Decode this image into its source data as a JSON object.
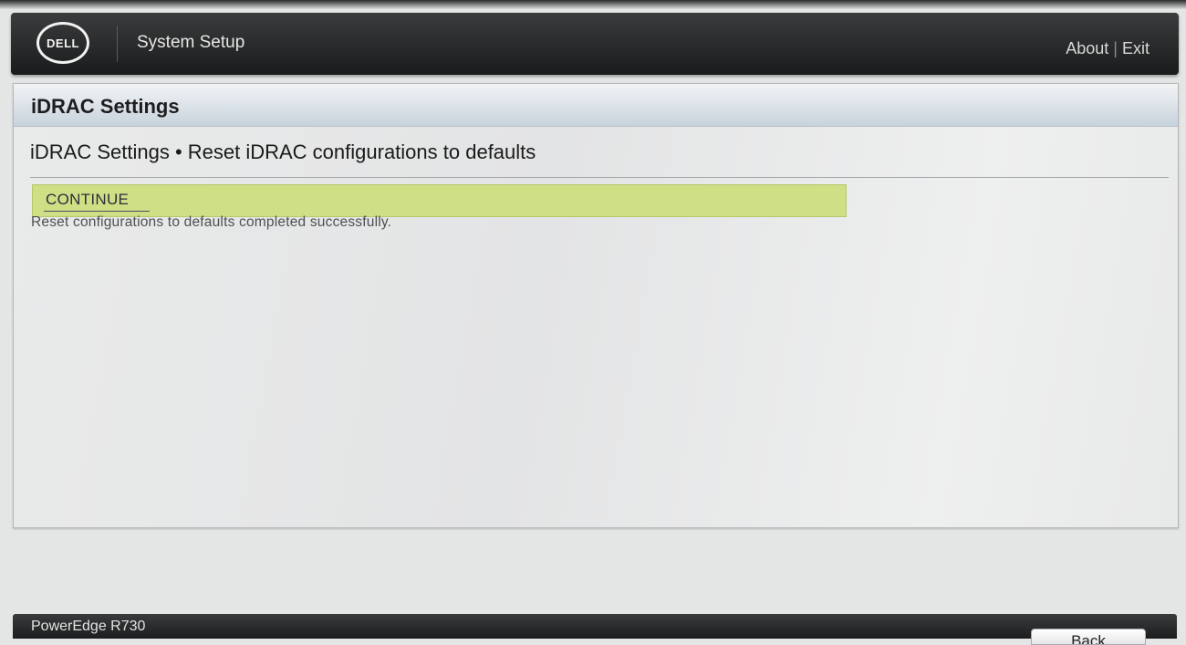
{
  "header": {
    "logo_text": "D⁠ELL",
    "title": "System Setup",
    "about_label": "About",
    "link_separator": "|",
    "exit_label": "Exit"
  },
  "panel": {
    "title": "iDRAC Settings",
    "breadcrumb": "iDRAC Settings • Reset iDRAC configurations to defaults",
    "continue_label": "CONTINUE",
    "status_message": "Reset configurations to defaults completed successfully."
  },
  "footer": {
    "model": "PowerEdge R730",
    "back_label": "Back"
  },
  "colors": {
    "header_bg": "#2a2b2c",
    "selection_highlight": "#cfdf86",
    "titlebar_accent": "#c7d3dc"
  }
}
